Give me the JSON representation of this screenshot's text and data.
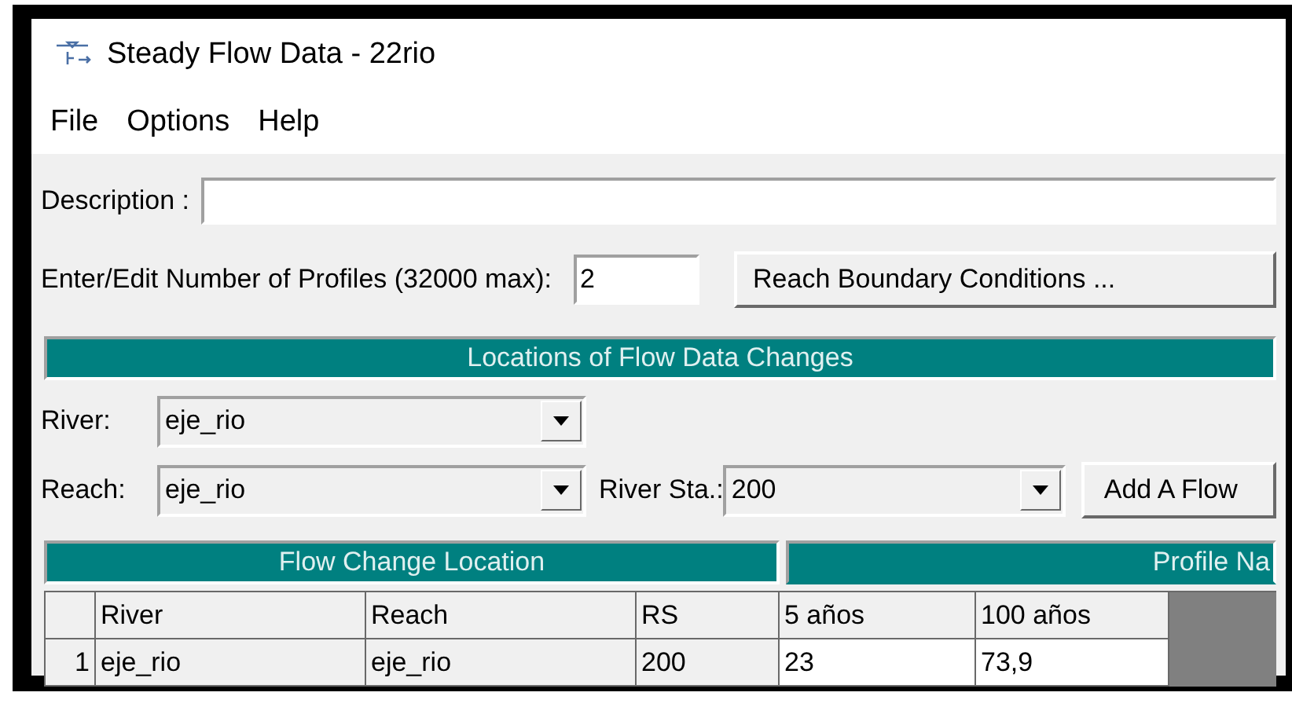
{
  "window": {
    "title": "Steady Flow Data - 22rio"
  },
  "menu": [
    "File",
    "Options",
    "Help"
  ],
  "description": {
    "label": "Description :"
  },
  "profiles": {
    "label": "Enter/Edit Number of Profiles (32000 max):",
    "value": "2"
  },
  "boundary_button": "Reach Boundary Conditions ...",
  "locations_header": "Locations of Flow Data Changes",
  "river": {
    "label": "River:",
    "value": "eje_rio"
  },
  "reach": {
    "label": "Reach:",
    "value": "eje_rio"
  },
  "river_sta": {
    "label": "River Sta.:",
    "value": "200"
  },
  "add_button": "Add A Flow",
  "table": {
    "group_left": "Flow Change Location",
    "group_right": "Profile Na",
    "columns": [
      "River",
      "Reach",
      "RS",
      "5 años",
      "100 años"
    ],
    "rows": [
      {
        "number": "1",
        "cells": [
          "eje_rio",
          "eje_rio",
          "200",
          "23",
          "73,9"
        ]
      }
    ]
  }
}
